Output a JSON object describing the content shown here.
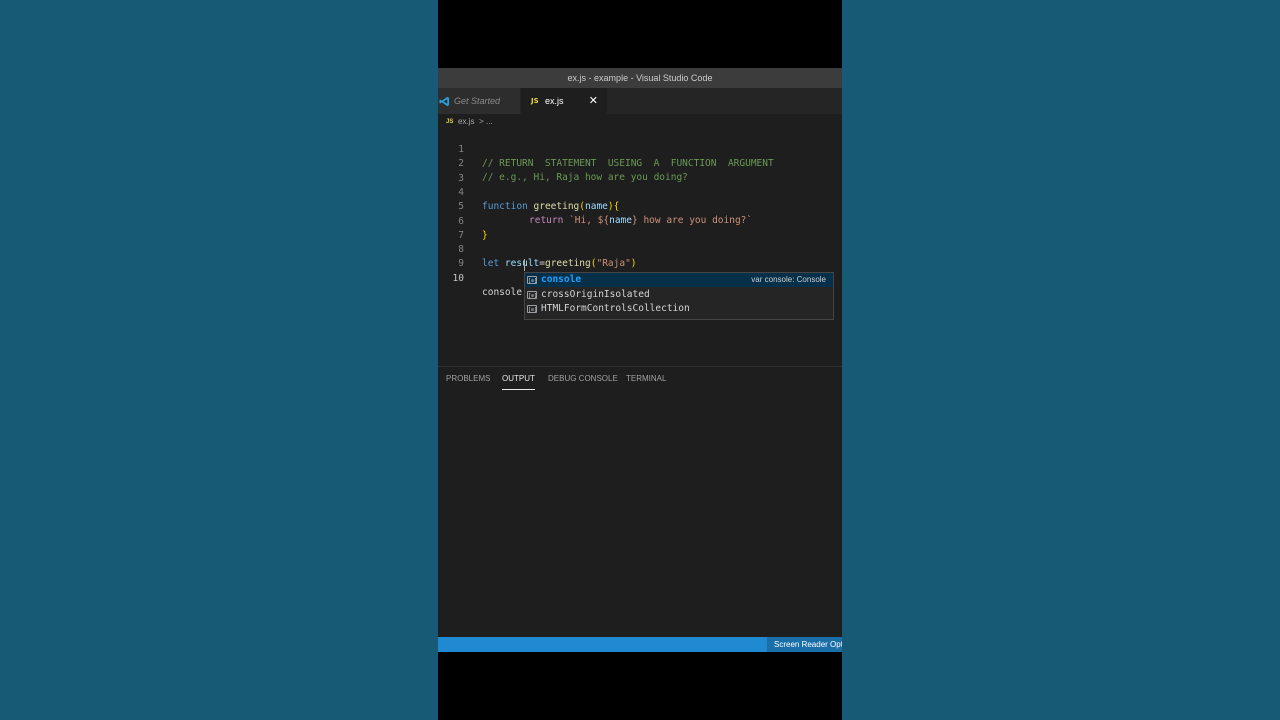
{
  "window": {
    "title": "ex.js - example - Visual Studio Code"
  },
  "tabs": [
    {
      "label": "Get Started",
      "icon": "vscode-logo-icon"
    },
    {
      "label": "ex.js",
      "badge": "JS",
      "close": "✕"
    }
  ],
  "breadcrumb": {
    "badge": "JS",
    "file": "ex.js",
    "separator": ">",
    "more": "..."
  },
  "editor": {
    "line_numbers": [
      "1",
      "2",
      "3",
      "4",
      "5",
      "6",
      "7",
      "8",
      "9",
      "10"
    ],
    "l1": "// RETURN  STATEMENT  USEING  A  FUNCTION  ARGUMENT",
    "l2": "// e.g., Hi, Raja how are you doing?",
    "l4": {
      "kw": "function",
      "fn": "greeting",
      "open": "(",
      "param": "name",
      "close": ")",
      "brace": "{"
    },
    "l5": {
      "ret": "return",
      "str_a": "`Hi, ${",
      "var": "name",
      "str_b": "} how are you doing?`"
    },
    "l6": "}",
    "l8": {
      "kw": "let",
      "var": "result",
      "eq": "=",
      "fn": "greeting",
      "open": "(",
      "str": "\"Raja\"",
      "close": ")"
    },
    "l10": "console"
  },
  "suggestions": [
    {
      "hl": "console",
      "rest": "",
      "detail": "var console: Console",
      "selected": true
    },
    {
      "text": "crossOriginIsolated"
    },
    {
      "text": "HTMLFormControlsCollection"
    }
  ],
  "panel": {
    "tabs": [
      "PROBLEMS",
      "OUTPUT",
      "DEBUG CONSOLE",
      "TERMINAL"
    ],
    "active": "OUTPUT"
  },
  "statusbar": {
    "item": "Screen Reader Optimized"
  },
  "colors": {
    "status_bar": "#1f8ad2",
    "background": "#165a76",
    "accent": "#18a3ff"
  }
}
